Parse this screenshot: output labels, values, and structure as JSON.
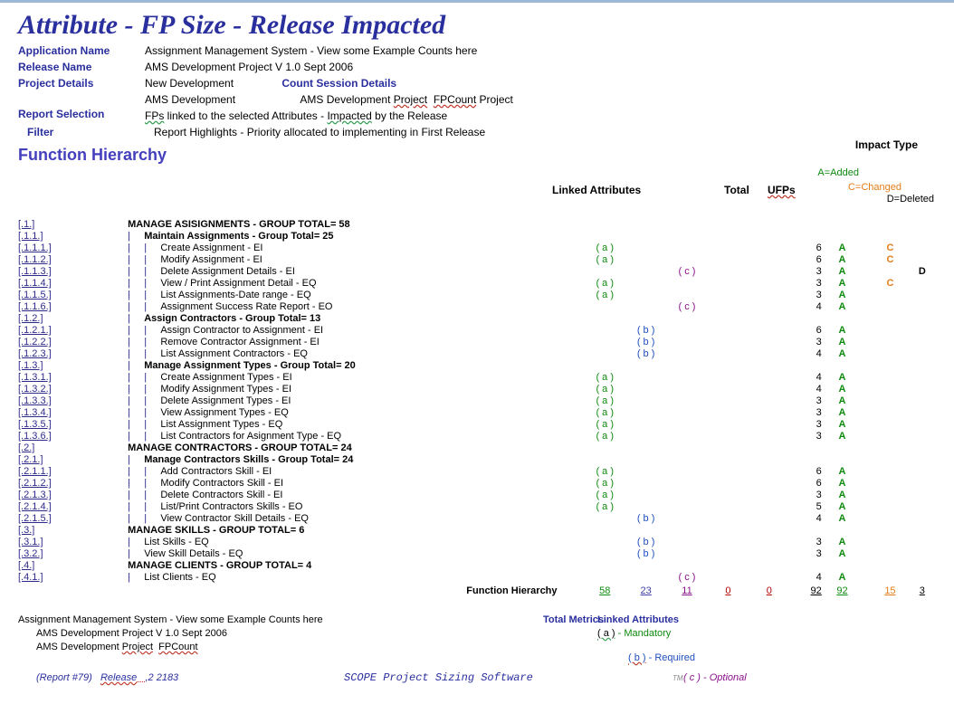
{
  "title": "Attribute - FP Size - Release Impacted",
  "header": {
    "app_name_label": "Application Name",
    "app_name": "Assignment Management System - View some Example Counts here",
    "release_name_label": "Release Name",
    "release_name": "AMS Development Project V 1.0 Sept 2006",
    "project_details_label": "Project Details",
    "project_details_1": "New Development",
    "count_session_label": "Count Session Details",
    "project_details_2": "AMS Development",
    "count_session_val_prefix": "AMS Development ",
    "count_session_val_proj": "Project",
    "count_session_val_fp": "FPCount",
    "count_session_val_suffix": " Project",
    "report_selection_label": "Report Selection",
    "report_selection_val_prefix": "FPs",
    "report_selection_val_mid": " linked to the selected Attributes -   ",
    "report_selection_val_imp": "Impacted",
    "report_selection_val_end": " by the Release",
    "filter_label": "Filter",
    "filter_val": "Report Highlights - Priority allocated to implementing in First Release",
    "impact_type": "Impact Type"
  },
  "function_hierarchy_label": "Function Hierarchy",
  "linked_attributes_label": "Linked Attributes",
  "total_label": "Total",
  "ufps_label": "UFPs",
  "impact_legend": {
    "a": "A=Added",
    "c": "C=Changed",
    "d": "D=Deleted"
  },
  "rows": [
    {
      "id": "[.1.]",
      "indent": 0,
      "text": "MANAGE ASISIGNMENTS - GROUP TOTAL= 58",
      "bold": true
    },
    {
      "id": "[.1.1.]",
      "indent": 1,
      "text": "Maintain Assignments - Group Total= 25",
      "bold": true
    },
    {
      "id": "[.1.1.1.]",
      "indent": 2,
      "text": "Create Assignment   -   EI",
      "attr": "( a )",
      "attr_col": 0,
      "ufp": "6",
      "impact": [
        "A",
        "",
        "C",
        ""
      ]
    },
    {
      "id": "[.1.1.2.]",
      "indent": 2,
      "text": "Modify Assignment   -   EI",
      "attr": "( a )",
      "attr_col": 0,
      "ufp": "6",
      "impact": [
        "A",
        "",
        "C",
        ""
      ]
    },
    {
      "id": "[.1.1.3.]",
      "indent": 2,
      "text": "Delete Assignment Details   -   EI",
      "attr": "( c )",
      "attr_col": 2,
      "ufp": "3",
      "impact": [
        "A",
        "",
        "",
        "D"
      ]
    },
    {
      "id": "[.1.1.4.]",
      "indent": 2,
      "text": "View / Print Assignment Detail   -   EQ",
      "attr": "( a )",
      "attr_col": 0,
      "ufp": "3",
      "impact": [
        "A",
        "",
        "C",
        ""
      ]
    },
    {
      "id": "[.1.1.5.]",
      "indent": 2,
      "text": "List Assignments-Date range   -   EQ",
      "attr": "( a )",
      "attr_col": 0,
      "ufp": "3",
      "impact": [
        "A",
        "",
        "",
        ""
      ]
    },
    {
      "id": "[.1.1.6.]",
      "indent": 2,
      "text": "Assignment Success Rate Report   -   EO",
      "attr": "( c )",
      "attr_col": 2,
      "ufp": "4",
      "impact": [
        "A",
        "",
        "",
        ""
      ]
    },
    {
      "id": "[.1.2.]",
      "indent": 1,
      "text": "Assign Contractors - Group Total= 13",
      "bold": true
    },
    {
      "id": "[.1.2.1.]",
      "indent": 2,
      "text": "Assign Contractor to Assignment   -   EI",
      "attr": "( b )",
      "attr_col": 1,
      "ufp": "6",
      "impact": [
        "A",
        "",
        "",
        ""
      ]
    },
    {
      "id": "[.1.2.2.]",
      "indent": 2,
      "text": "Remove Contractor  Assignment   -   EI",
      "attr": "( b )",
      "attr_col": 1,
      "ufp": "3",
      "impact": [
        "A",
        "",
        "",
        ""
      ]
    },
    {
      "id": "[.1.2.3.]",
      "indent": 2,
      "text": "List Assignment Contractors   -   EQ",
      "attr": "( b )",
      "attr_col": 1,
      "ufp": "4",
      "impact": [
        "A",
        "",
        "",
        ""
      ]
    },
    {
      "id": "[.1.3.]",
      "indent": 1,
      "text": "Manage Assignment Types - Group Total= 20",
      "bold": true
    },
    {
      "id": "[.1.3.1.]",
      "indent": 2,
      "text": "Create Assignment Types   -   EI",
      "attr": "( a )",
      "attr_col": 0,
      "ufp": "4",
      "impact": [
        "A",
        "",
        "",
        ""
      ]
    },
    {
      "id": "[.1.3.2.]",
      "indent": 2,
      "text": "Modify Assignment Types   -   EI",
      "attr": "( a )",
      "attr_col": 0,
      "ufp": "4",
      "impact": [
        "A",
        "",
        "",
        ""
      ]
    },
    {
      "id": "[.1.3.3.]",
      "indent": 2,
      "text": "Delete Assignment Types   -   EI",
      "attr": "( a )",
      "attr_col": 0,
      "ufp": "3",
      "impact": [
        "A",
        "",
        "",
        ""
      ]
    },
    {
      "id": "[.1.3.4.]",
      "indent": 2,
      "text": "View Assignment Types   -   EQ",
      "attr": "( a )",
      "attr_col": 0,
      "ufp": "3",
      "impact": [
        "A",
        "",
        "",
        ""
      ]
    },
    {
      "id": "[.1.3.5.]",
      "indent": 2,
      "text": "List Assignment Types   -   EQ",
      "attr": "( a )",
      "attr_col": 0,
      "ufp": "3",
      "impact": [
        "A",
        "",
        "",
        ""
      ]
    },
    {
      "id": "[.1.3.6.]",
      "indent": 2,
      "text": "List Contractors for Asignment Type   -   EQ",
      "attr": "( a )",
      "attr_col": 0,
      "ufp": "3",
      "impact": [
        "A",
        "",
        "",
        ""
      ]
    },
    {
      "id": "[.2.]",
      "indent": 0,
      "text": "MANAGE CONTRACTORS - GROUP TOTAL= 24",
      "bold": true
    },
    {
      "id": "[.2.1.]",
      "indent": 1,
      "text": "Manage Contractors Skills - Group Total= 24",
      "bold": true
    },
    {
      "id": "[.2.1.1.]",
      "indent": 2,
      "text": "Add Contractors Skill   -   EI",
      "attr": "( a )",
      "attr_col": 0,
      "ufp": "6",
      "impact": [
        "A",
        "",
        "",
        ""
      ]
    },
    {
      "id": "[.2.1.2.]",
      "indent": 2,
      "text": "Modify Contractors Skill   -   EI",
      "attr": "( a )",
      "attr_col": 0,
      "ufp": "6",
      "impact": [
        "A",
        "",
        "",
        ""
      ]
    },
    {
      "id": "[.2.1.3.]",
      "indent": 2,
      "text": "Delete Contractors Skill   -   EI",
      "attr": "( a )",
      "attr_col": 0,
      "ufp": "3",
      "impact": [
        "A",
        "",
        "",
        ""
      ]
    },
    {
      "id": "[.2.1.4.]",
      "indent": 2,
      "text": "List/Print Contractors Skills   -   EO",
      "attr": "( a )",
      "attr_col": 0,
      "ufp": "5",
      "impact": [
        "A",
        "",
        "",
        ""
      ]
    },
    {
      "id": "[.2.1.5.]",
      "indent": 2,
      "text": "View Contractor Skill Details   -   EQ",
      "attr": "( b )",
      "attr_col": 1,
      "ufp": "4",
      "impact": [
        "A",
        "",
        "",
        ""
      ]
    },
    {
      "id": "[.3.]",
      "indent": 0,
      "text": "MANAGE SKILLS - GROUP TOTAL= 6",
      "bold": true
    },
    {
      "id": "[.3.1.]",
      "indent": 1,
      "text": "List Skills   -   EQ",
      "attr": "( b )",
      "attr_col": 1,
      "ufp": "3",
      "impact": [
        "A",
        "",
        "",
        ""
      ]
    },
    {
      "id": "[.3.2.]",
      "indent": 1,
      "text": "View Skill Details   -   EQ",
      "attr": "( b )",
      "attr_col": 1,
      "ufp": "3",
      "impact": [
        "A",
        "",
        "",
        ""
      ]
    },
    {
      "id": "[.4.]",
      "indent": 0,
      "text": "MANAGE CLIENTS - GROUP TOTAL= 4",
      "bold": true
    },
    {
      "id": "[.4.1.]",
      "indent": 1,
      "text": "List Clients   -   EQ",
      "attr": "( c )",
      "attr_col": 2,
      "ufp": "4",
      "impact": [
        "A",
        "",
        "",
        ""
      ]
    }
  ],
  "summary": {
    "label": "Function Hierarchy",
    "a": "58",
    "b": "23",
    "c": "11",
    "d": "0",
    "e": "0",
    "tot": "92",
    "ufp": "92",
    "chg": "15",
    "del": "3"
  },
  "footer": {
    "line1": "Assignment Management System - View some Example Counts here",
    "total_metrics": "Total Metrics",
    "linked_attr": "Linked Attributes",
    "line2": "AMS Development Project V 1.0 Sept 2006",
    "line3_prefix": "AMS Development ",
    "line3_proj": "Project",
    "line3_fp": "FPCount",
    "legend_a": "( a )",
    "legend_a_txt": " - Mandatory",
    "legend_b": "( b )",
    "legend_b_txt": " - Required",
    "legend_c": "( c )",
    "legend_c_txt": " - Optional",
    "report_no": "(Report #79)",
    "release_prefix": "Release",
    "release_suffix": "2 2183",
    "scope": "SCOPE Project Sizing Software",
    "tm": "TM"
  }
}
